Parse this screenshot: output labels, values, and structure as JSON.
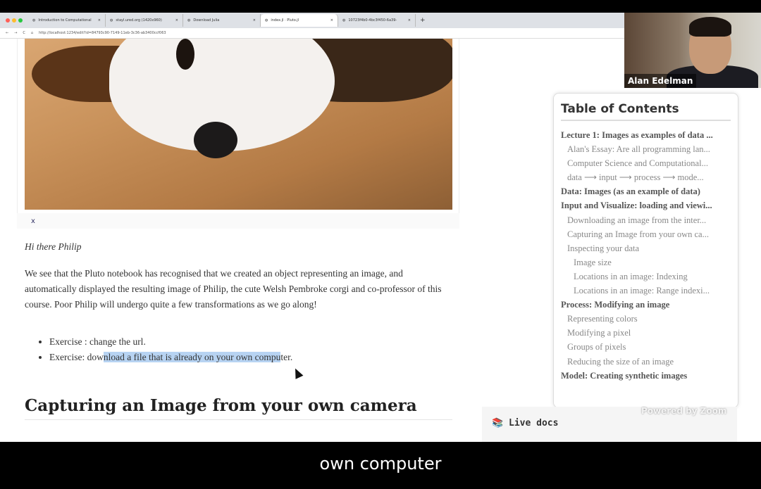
{
  "browser": {
    "tabs": [
      {
        "label": "Introduction to Computational",
        "active": false
      },
      {
        "label": "stayl.ured.org (1420x960)",
        "active": false
      },
      {
        "label": "Download Julia",
        "active": false
      },
      {
        "label": "index.jl · Pluto.jl",
        "active": true
      },
      {
        "label": "10723f4b0-4bc3f450-6a39-",
        "active": false
      }
    ],
    "new_tab": "+",
    "close": "×",
    "url": "http://localhost:1234/edit?id=84793c90-7149-11eb-3c36-ab3400ccf063"
  },
  "notebook": {
    "output_label": "x",
    "greeting": "Hi there Philip",
    "paragraph": "We see that the Pluto notebook has recognised that we created an object representing an image, and automatically displayed the resulting image of Philip, the cute Welsh Pembroke corgi and co-professor of this course. Poor Philip will undergo quite a few transformations as we go along!",
    "exercise1": "Exercise : change the url.",
    "exercise2_pre": "Exercise: dow",
    "exercise2_sel": "nload a file that is already on your own compu",
    "exercise2_post": "ter.",
    "heading": "Capturing an Image from your own camera"
  },
  "toc": {
    "title": "Table of Contents",
    "items": [
      {
        "label": "Lecture 1: Images as examples of data ...",
        "level": 1
      },
      {
        "label": "Alan's Essay: Are all programming lan...",
        "level": 2
      },
      {
        "label": "Computer Science and Computational...",
        "level": 2
      },
      {
        "label": "data ⟶ input ⟶ process ⟶ mode...",
        "level": 2
      },
      {
        "label": "Data: Images (as an example of data)",
        "level": 1
      },
      {
        "label": "Input and Visualize: loading and viewi...",
        "level": 1
      },
      {
        "label": "Downloading an image from the inter...",
        "level": 2
      },
      {
        "label": "Capturing an Image from your own ca...",
        "level": 2
      },
      {
        "label": "Inspecting your data",
        "level": 2
      },
      {
        "label": "Image size",
        "level": 3
      },
      {
        "label": "Locations in an image: Indexing",
        "level": 3
      },
      {
        "label": "Locations in an image: Range indexi...",
        "level": 3
      },
      {
        "label": "Process: Modifying an image",
        "level": 1
      },
      {
        "label": "Representing colors",
        "level": 2
      },
      {
        "label": "Modifying a pixel",
        "level": 2
      },
      {
        "label": "Groups of pixels",
        "level": 2
      },
      {
        "label": "Reducing the size of an image",
        "level": 2
      },
      {
        "label": "Model: Creating synthetic images",
        "level": 1
      }
    ]
  },
  "live_docs": {
    "icon": "books-icon",
    "label": "Live docs"
  },
  "watermark": "Powered by Zoom",
  "video": {
    "participant": "Alan Edelman"
  },
  "caption": "own computer"
}
